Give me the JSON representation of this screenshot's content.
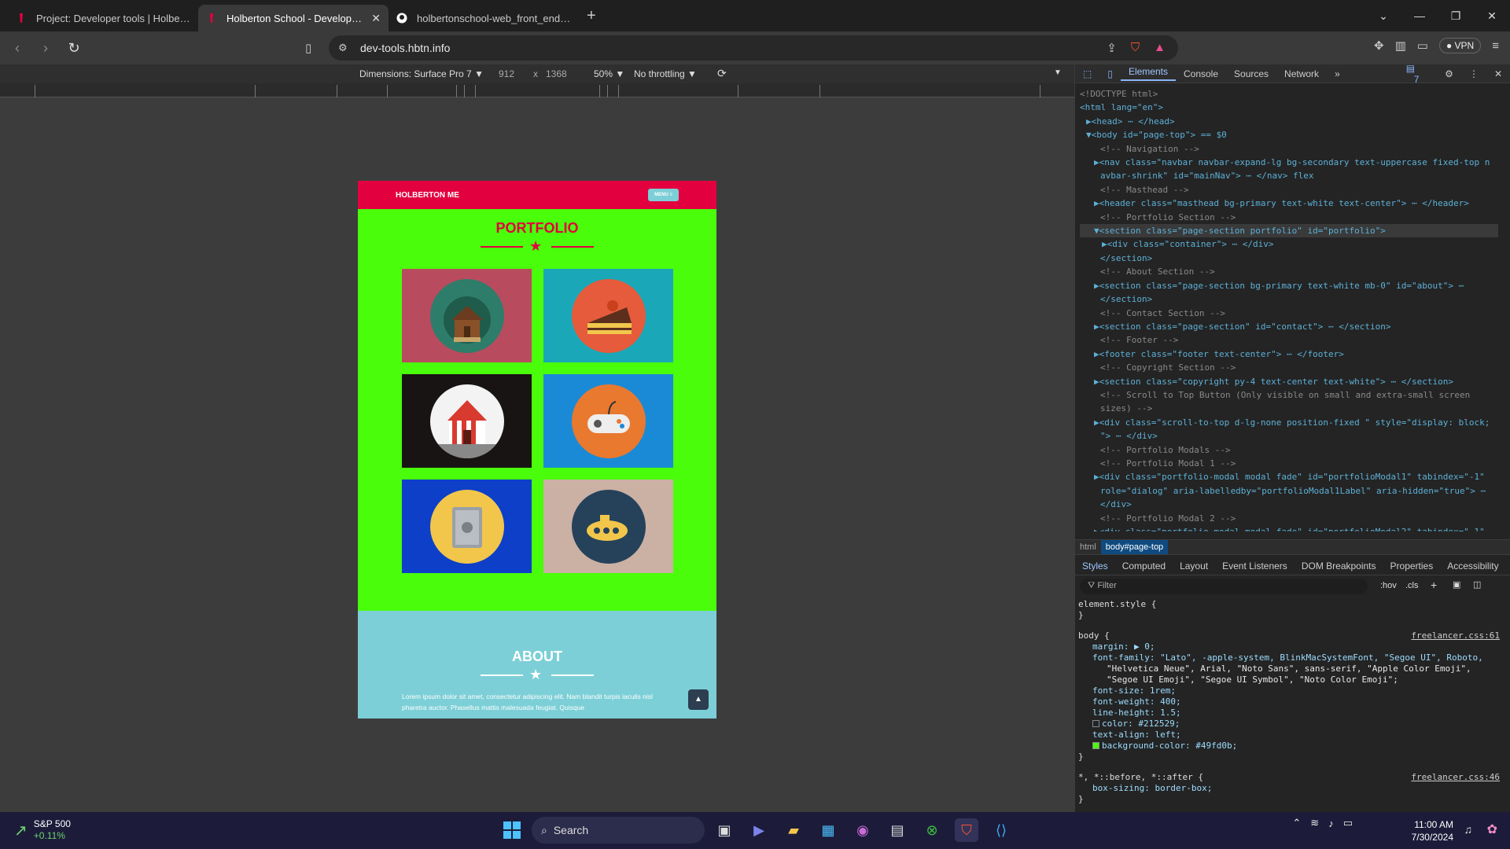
{
  "browser": {
    "tabs": [
      {
        "label": "Project: Developer tools | Holberton",
        "active": false
      },
      {
        "label": "Holberton School - Developer tools",
        "active": true
      },
      {
        "label": "holbertonschool-web_front_end/dev",
        "active": false
      }
    ],
    "url": "dev-tools.hbtn.info",
    "vpn_label": "VPN"
  },
  "device_toolbar": {
    "dimensions": "Dimensions: Surface Pro 7 ▼",
    "width": "912",
    "times": "x",
    "height": "1368",
    "zoom": "50% ▼",
    "throttle": "No throttling ▼"
  },
  "site": {
    "brand": "HOLBERTON ME",
    "menu": "MENU ≡",
    "portfolio_title": "PORTFOLIO",
    "about_title": "ABOUT",
    "about_text": "Lorem ipsum dolor sit amet, consectetur adipiscing elit. Nam blandit turpis iaculis nisl pharetra auctor. Phasellus mattis malesuada feugiat. Quisque",
    "cards": [
      {
        "name": "cabin",
        "color": "#b94b5e",
        "circle": "#2e7d6a"
      },
      {
        "name": "cake",
        "color": "#1aa8b8",
        "circle": "#e55b3c"
      },
      {
        "name": "circus",
        "color": "#181414",
        "circle": "#f3f3f3"
      },
      {
        "name": "game",
        "color": "#1b8ad6",
        "circle": "#e8792f"
      },
      {
        "name": "safe",
        "color": "#0d3fc8",
        "circle": "#f2c64b"
      },
      {
        "name": "submarine",
        "color": "#cbb0a4",
        "circle": "#25425a"
      }
    ]
  },
  "devtools": {
    "tabs": [
      "Elements",
      "Console",
      "Sources",
      "Network",
      "»"
    ],
    "issues": "7",
    "breadcrumbs": [
      "html",
      "body#page-top"
    ],
    "style_tabs": [
      "Styles",
      "Computed",
      "Layout",
      "Event Listeners",
      "DOM Breakpoints",
      "Properties",
      "Accessibility"
    ],
    "filter_placeholder": "Filter",
    "hov": ":hov",
    "cls": ".cls",
    "elements": [
      "<!DOCTYPE html>",
      "<html lang=\"en\">",
      "▶<head> ⋯ </head>",
      "▼<body id=\"page-top\"> == $0",
      "<!-- Navigation -->",
      "▶<nav class=\"navbar navbar-expand-lg bg-secondary text-uppercase fixed-top n",
      "avbar-shrink\" id=\"mainNav\"> ⋯ </nav> flex",
      "<!-- Masthead -->",
      "▶<header class=\"masthead bg-primary text-white text-center\"> ⋯ </header>",
      "<!-- Portfolio Section -->",
      "▼<section class=\"page-section portfolio\" id=\"portfolio\">",
      "▶<div class=\"container\"> ⋯ </div>",
      "</section>",
      "<!-- About Section -->",
      "▶<section class=\"page-section bg-primary text-white mb-0\" id=\"about\"> ⋯",
      "</section>",
      "<!-- Contact Section -->",
      "▶<section class=\"page-section\" id=\"contact\"> ⋯ </section>",
      "<!-- Footer -->",
      "▶<footer class=\"footer text-center\"> ⋯ </footer>",
      "<!-- Copyright Section -->",
      "▶<section class=\"copyright py-4 text-center text-white\"> ⋯ </section>",
      "<!-- Scroll to Top Button (Only visible on small and extra-small screen",
      "sizes) -->",
      "▶<div class=\"scroll-to-top d-lg-none position-fixed \" style=\"display: block;",
      "\"> ⋯ </div>",
      "<!-- Portfolio Modals -->",
      "<!-- Portfolio Modal 1 -->",
      "▶<div class=\"portfolio-modal modal fade\" id=\"portfolioModal1\" tabindex=\"-1\"",
      "role=\"dialog\" aria-labelledby=\"portfolioModal1Label\" aria-hidden=\"true\"> ⋯",
      "</div>",
      "<!-- Portfolio Modal 2 -->",
      "▶<div class=\"portfolio-modal modal fade\" id=\"portfolioModal2\" tabindex=\"-1\""
    ],
    "styles": {
      "element_style": "element.style {",
      "close": "}",
      "body_selector": "body {",
      "body_source": "freelancer.css:61",
      "body_rules": [
        "margin: ▶ 0;",
        "font-family: \"Lato\", -apple-system, BlinkMacSystemFont, \"Segoe UI\", Roboto,",
        "\"Helvetica Neue\", Arial, \"Noto Sans\", sans-serif, \"Apple Color Emoji\",",
        "\"Segoe UI Emoji\", \"Segoe UI Symbol\", \"Noto Color Emoji\";",
        "font-size: 1rem;",
        "font-weight: 400;",
        "line-height: 1.5;",
        "color: #212529;",
        "text-align: left;",
        "background-color: #49fd0b;"
      ],
      "universal_selector": "*, *::before, *::after {",
      "universal_source": "freelancer.css:46",
      "universal_rule": "box-sizing: border-box;"
    }
  },
  "taskbar": {
    "stock_name": "S&P 500",
    "stock_change": "+0.11%",
    "search": "Search",
    "time": "11:00 AM",
    "date": "7/30/2024"
  },
  "colors": {
    "accent_red": "#e2003f",
    "page_green": "#49fd0b",
    "about_teal": "#7ccfd6"
  }
}
